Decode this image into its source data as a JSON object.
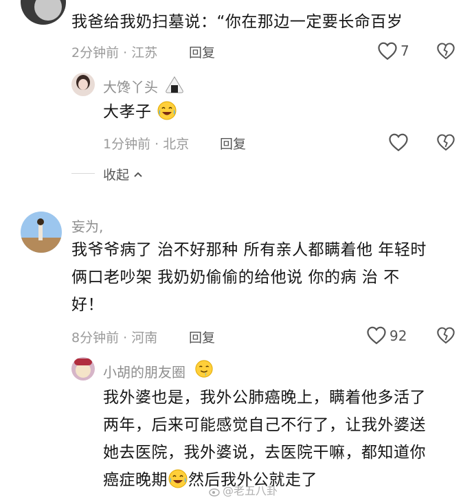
{
  "comments": [
    {
      "content": "我爸给我奶扫墓说：“你在那边一定要长命百岁",
      "time_location": "2分钟前 · 江苏",
      "reply_label": "回复",
      "like_count": "7",
      "replies": [
        {
          "username": "大馋丫头",
          "content": "大孝子",
          "time_location": "1分钟前 · 北京",
          "reply_label": "回复"
        }
      ],
      "collapse_label": "收起"
    },
    {
      "username": "妄为,",
      "content_lines": [
        "我爷爷病了 治不好那种 所有亲人都瞒着他 年轻时",
        "俩口老吵架 我奶奶偷偷的给他说 你的病 治 不",
        "好！"
      ],
      "time_location": "8分钟前 · 河南",
      "reply_label": "回复",
      "like_count": "92",
      "replies": [
        {
          "username": "小胡的朋友圈",
          "content_lines": [
            "我外婆也是，我外公肺癌晚上，瞒着他多活了",
            "两年，后来可能感觉自己不行了，让我外婆送",
            "她去医院，我外婆说，去医院干嘛，都知道你",
            "癌症晚期",
            "然后我外公就走了"
          ]
        }
      ]
    }
  ],
  "watermark": "@老五八卦",
  "colors": {
    "text": "#161616",
    "meta": "#9a9a9a",
    "name": "#8e8e8e",
    "icon": "#555555"
  }
}
